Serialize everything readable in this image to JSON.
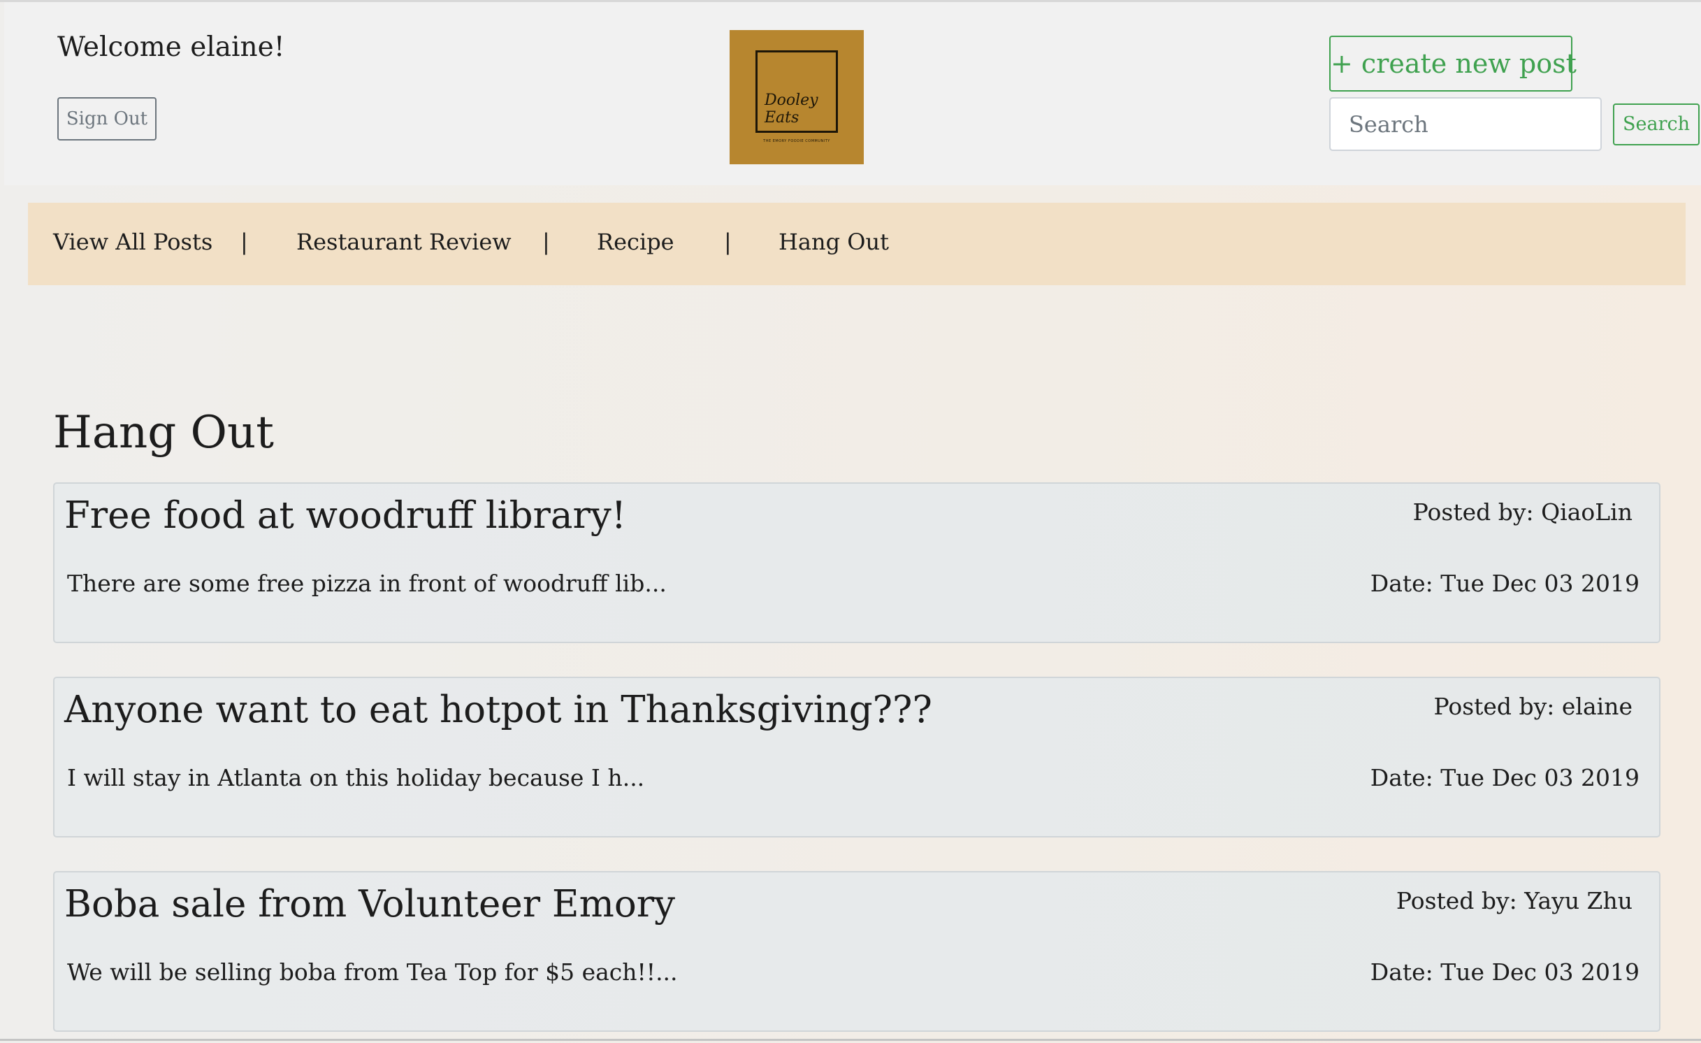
{
  "header": {
    "welcome_text": "Welcome elaine!",
    "sign_out_label": "Sign Out",
    "logo": {
      "name": "Dooley\nEats",
      "tagline": "THE EMORY FOODIE COMMUNITY",
      "background_color": "#b7862f"
    },
    "create_post_label": "+ create new post",
    "search_placeholder": "Search",
    "search_value": "",
    "search_button_label": "Search"
  },
  "nav": {
    "items": [
      {
        "label": "View All Posts"
      },
      {
        "label": "Restaurant Review"
      },
      {
        "label": "Recipe"
      },
      {
        "label": "Hang Out"
      }
    ],
    "separator": "|",
    "background_color": "#f2e0c6"
  },
  "main": {
    "title": "Hang Out",
    "posts": [
      {
        "title": "Free food at woodruff library!",
        "author": "Posted by: QiaoLin",
        "excerpt": "There are some free pizza in front of woodruff lib...",
        "date": "Date: Tue Dec 03 2019"
      },
      {
        "title": "Anyone want to eat hotpot in Thanksgiving???",
        "author": "Posted by: elaine",
        "excerpt": "I will stay in Atlanta on this holiday because I h...",
        "date": "Date: Tue Dec 03 2019"
      },
      {
        "title": "Boba sale from Volunteer Emory",
        "author": "Posted by: Yayu Zhu",
        "excerpt": "We will be selling boba from Tea Top for $5 each!!...",
        "date": "Date: Tue Dec 03 2019"
      }
    ]
  },
  "colors": {
    "accent_green": "#3fa14f",
    "secondary_gray": "#6c757d"
  }
}
